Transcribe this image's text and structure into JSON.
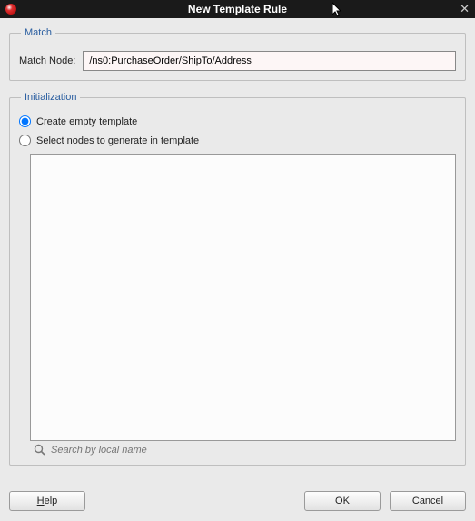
{
  "titlebar": {
    "title": "New Template Rule"
  },
  "match": {
    "legend": "Match",
    "label": "Match Node:",
    "value": "/ns0:PurchaseOrder/ShipTo/Address"
  },
  "init": {
    "legend": "Initialization",
    "options": {
      "create_empty": "Create empty template",
      "select_nodes": "Select nodes to generate in template"
    },
    "selected": "create_empty",
    "search_placeholder": "Search by local name"
  },
  "buttons": {
    "help": "Help",
    "ok": "OK",
    "cancel": "Cancel"
  }
}
